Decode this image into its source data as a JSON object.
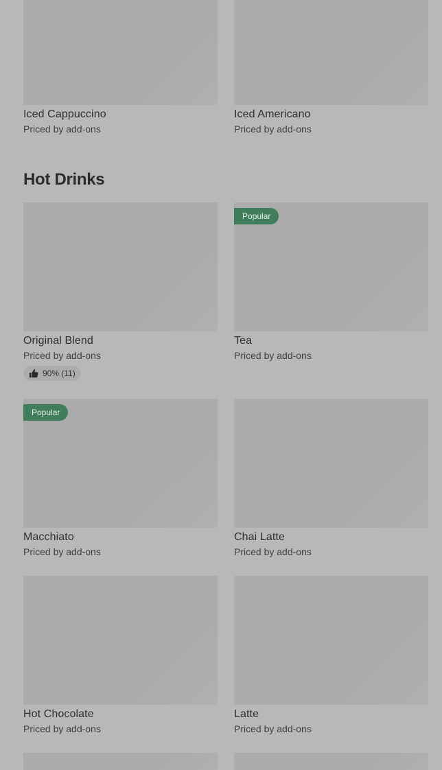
{
  "top_items": [
    {
      "name": "Iced Cappuccino",
      "price": "Priced by add-ons"
    },
    {
      "name": "Iced Americano",
      "price": "Priced by add-ons"
    }
  ],
  "hot_drinks": {
    "title": "Hot Drinks",
    "items": [
      {
        "name": "Original Blend",
        "price": "Priced by add-ons",
        "rating": "90% (11)"
      },
      {
        "name": "Tea",
        "price": "Priced by add-ons",
        "badge": "Popular"
      },
      {
        "name": "Macchiato",
        "price": "Priced by add-ons",
        "badge": "Popular"
      },
      {
        "name": "Chai Latte",
        "price": "Priced by add-ons"
      },
      {
        "name": "Hot Chocolate",
        "price": "Priced by add-ons"
      },
      {
        "name": "Latte",
        "price": "Priced by add-ons"
      }
    ]
  },
  "icons": {
    "rating": "thumbs-up-icon"
  },
  "colors": {
    "background": "#b8b8b8",
    "image_placeholder": "#ababab",
    "popular_badge": "#3f7d5b",
    "rating_pill": "#acacac"
  }
}
